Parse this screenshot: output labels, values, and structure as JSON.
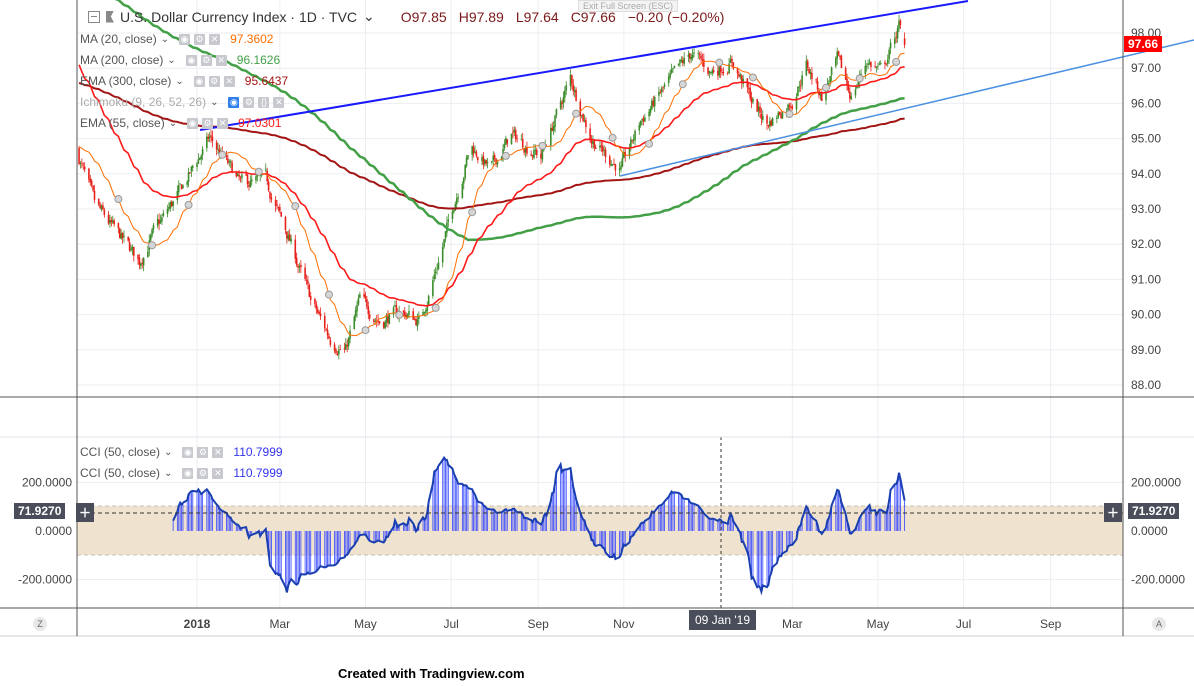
{
  "header": {
    "symbol_title": "U.S. Dollar Currency Index · 1D · TVC",
    "open": "O97.85",
    "high": "H97.89",
    "low": "L97.64",
    "close": "C97.66",
    "change": "−0.20 (−0.20%)",
    "exit_fullscreen": "Exit Full Screen (ESC)"
  },
  "indicators": [
    {
      "label": "MA (20, close)",
      "value": "97.3602",
      "color": "#ff6d00"
    },
    {
      "label": "MA (200, close)",
      "value": "96.1626",
      "color": "#43a047"
    },
    {
      "label": "EMA (300, close)",
      "value": "95.6437",
      "color": "#a31515"
    },
    {
      "label": "Ichimoku (9, 26, 52, 26)",
      "value": "",
      "color": "#999999"
    },
    {
      "label": "EMA (55, close)",
      "value": "97.0301",
      "color": "#ff1a1a"
    }
  ],
  "cci_legend": [
    {
      "label": "CCI (50, close)",
      "value": "110.7999"
    },
    {
      "label": "CCI (50, close)",
      "value": "110.7999"
    }
  ],
  "price_axis": {
    "labels": [
      "98.00",
      "97.00",
      "96.00",
      "95.00",
      "94.00",
      "93.00",
      "92.00",
      "91.00",
      "90.00",
      "89.00",
      "88.00"
    ],
    "last_price": "97.66",
    "last_price_color": "#ff0000"
  },
  "cci_axis": {
    "labels": [
      "200.0000",
      "0.0000",
      "-200.0000"
    ],
    "crosshair_value": "71.9270"
  },
  "time_axis": {
    "labels": [
      {
        "text": "2018",
        "date": "2018-01-01"
      },
      {
        "text": "Mar",
        "date": "2018-03-01"
      },
      {
        "text": "May",
        "date": "2018-05-01"
      },
      {
        "text": "Jul",
        "date": "2018-07-01"
      },
      {
        "text": "Sep",
        "date": "2018-09-01"
      },
      {
        "text": "Nov",
        "date": "2018-11-01"
      },
      {
        "text": "Mar",
        "date": "2019-03-01"
      },
      {
        "text": "May",
        "date": "2019-05-01"
      },
      {
        "text": "Jul",
        "date": "2019-07-01"
      },
      {
        "text": "Sep",
        "date": "2019-09-01"
      }
    ],
    "crosshair_label": "09 Jan '19"
  },
  "buttons": {
    "z": "Z",
    "a": "A"
  },
  "footer": "Created with Tradingview.com",
  "chart_data": {
    "type": "candlestick",
    "title": "U.S. Dollar Currency Index · 1D · TVC",
    "ylim": [
      87.6,
      99.1
    ],
    "cci_ylim": [
      -320,
      360
    ],
    "cci_band": [
      -100,
      100
    ],
    "colors": {
      "up": "#3b8c2a",
      "down": "#e8201a",
      "cci": "#1a3fb0",
      "cci_bar": "#3344ff",
      "band": "#efe3cf"
    },
    "close_path": [
      {
        "date": "2017-10-07",
        "close": 94.7
      },
      {
        "date": "2017-10-20",
        "close": 93.1
      },
      {
        "date": "2017-11-21",
        "close": 91.5
      },
      {
        "date": "2017-11-28",
        "close": 92.1
      },
      {
        "date": "2017-12-20",
        "close": 93.5
      },
      {
        "date": "2018-01-10",
        "close": 95.0
      },
      {
        "date": "2018-02-01",
        "close": 93.7
      },
      {
        "date": "2018-02-19",
        "close": 93.8
      },
      {
        "date": "2018-03-08",
        "close": 92.1
      },
      {
        "date": "2018-03-23",
        "close": 90.4
      },
      {
        "date": "2018-04-06",
        "close": 89.3
      },
      {
        "date": "2018-04-17",
        "close": 89.0
      },
      {
        "date": "2018-04-27",
        "close": 90.4
      },
      {
        "date": "2018-05-12",
        "close": 89.8
      },
      {
        "date": "2018-05-26",
        "close": 90.1
      },
      {
        "date": "2018-06-09",
        "close": 89.8
      },
      {
        "date": "2018-06-24",
        "close": 91.8
      },
      {
        "date": "2018-07-04",
        "close": 93.3
      },
      {
        "date": "2018-07-15",
        "close": 94.8
      },
      {
        "date": "2018-07-29",
        "close": 94.1
      },
      {
        "date": "2018-08-13",
        "close": 95.1
      },
      {
        "date": "2018-09-03",
        "close": 94.5
      },
      {
        "date": "2018-09-24",
        "close": 96.7
      },
      {
        "date": "2018-10-09",
        "close": 95.0
      },
      {
        "date": "2018-10-30",
        "close": 94.1
      },
      {
        "date": "2018-11-13",
        "close": 95.5
      },
      {
        "date": "2018-12-05",
        "close": 96.7
      },
      {
        "date": "2018-12-19",
        "close": 97.4
      },
      {
        "date": "2019-01-02",
        "close": 96.9
      },
      {
        "date": "2019-01-17",
        "close": 97.2
      },
      {
        "date": "2019-01-31",
        "close": 96.1
      },
      {
        "date": "2019-02-11",
        "close": 95.4
      },
      {
        "date": "2019-03-01",
        "close": 96.1
      },
      {
        "date": "2019-03-11",
        "close": 97.1
      },
      {
        "date": "2019-03-22",
        "close": 96.2
      },
      {
        "date": "2019-04-02",
        "close": 97.2
      },
      {
        "date": "2019-04-12",
        "close": 96.2
      },
      {
        "date": "2019-04-23",
        "close": 97.2
      },
      {
        "date": "2019-05-04",
        "close": 96.9
      },
      {
        "date": "2019-05-16",
        "close": 98.2
      },
      {
        "date": "2019-05-20",
        "close": 97.66
      }
    ],
    "last_bar": {
      "open": 97.85,
      "high": 97.89,
      "low": 97.64,
      "close": 97.66
    }
  }
}
